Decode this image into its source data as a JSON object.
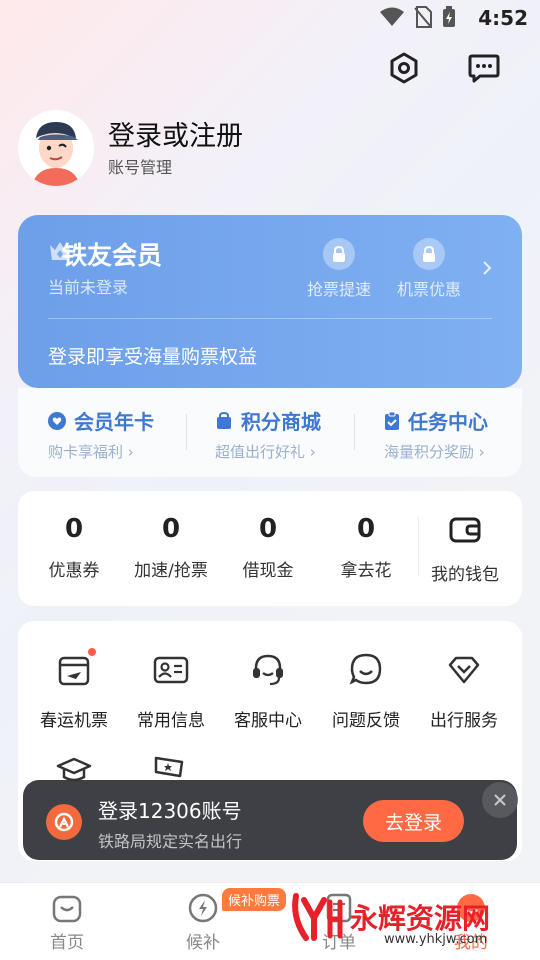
{
  "status_bar": {
    "time": "4:52"
  },
  "profile": {
    "title": "登录或注册",
    "subtitle": "账号管理"
  },
  "member_card": {
    "title": "铁友会员",
    "subtitle": "当前未登录",
    "perks": [
      {
        "label": "抢票提速",
        "icon": "lock-icon"
      },
      {
        "label": "机票优惠",
        "icon": "lock-icon"
      }
    ],
    "promo": "登录即享受海量购票权益"
  },
  "quick_links": [
    {
      "title": "会员年卡",
      "subtitle": "购卡享福利",
      "icon": "heart-icon"
    },
    {
      "title": "积分商城",
      "subtitle": "超值出行好礼",
      "icon": "shopping-bag-icon"
    },
    {
      "title": "任务中心",
      "subtitle": "海量积分奖励",
      "icon": "clipboard-icon"
    }
  ],
  "stats": [
    {
      "value": "0",
      "label": "优惠券"
    },
    {
      "value": "0",
      "label": "加速/抢票"
    },
    {
      "value": "0",
      "label": "借现金"
    },
    {
      "value": "0",
      "label": "拿去花"
    }
  ],
  "wallet": {
    "label": "我的钱包"
  },
  "services": [
    {
      "label": "春运机票",
      "icon": "plane-calendar-icon"
    },
    {
      "label": "常用信息",
      "icon": "id-card-icon"
    },
    {
      "label": "客服中心",
      "icon": "headset-icon"
    },
    {
      "label": "问题反馈",
      "icon": "feedback-icon"
    },
    {
      "label": "出行服务",
      "icon": "diamond-icon"
    }
  ],
  "toast": {
    "title": "登录12306账号",
    "subtitle": "铁路局规定实名出行",
    "button": "去登录"
  },
  "bottom_nav": {
    "items": [
      {
        "label": "首页"
      },
      {
        "label": "候补"
      },
      {
        "label": "订单"
      },
      {
        "label": "我的"
      }
    ],
    "badge": "候补购票"
  },
  "watermark": {
    "text": "永辉资源网",
    "url": "www.yhkjw.com"
  },
  "colors": {
    "accent": "#3f78d0",
    "member_card": "#7aaaf0",
    "cta": "#ff6a45"
  }
}
